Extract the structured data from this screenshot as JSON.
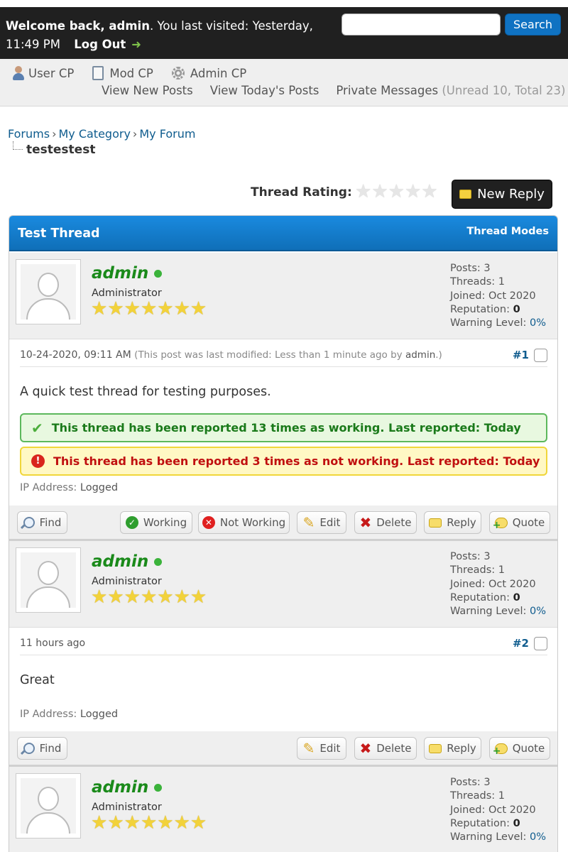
{
  "header": {
    "welcome_bold": "Welcome back, admin",
    "welcome_rest": ". You last visited: Yesterday,",
    "visit_time": "11:49 PM",
    "logout_label": "Log Out",
    "search_placeholder": "",
    "search_button": "Search"
  },
  "nav": {
    "user_cp": "User CP",
    "mod_cp": "Mod CP",
    "admin_cp": "Admin CP",
    "view_new_posts": "View New Posts",
    "view_todays_posts": "View Today's Posts",
    "private_messages": "Private Messages",
    "pm_counts": "(Unread 10, Total 23)"
  },
  "breadcrumb": {
    "forums": "Forums",
    "category": "My Category",
    "forum": "My Forum",
    "current": "testestest"
  },
  "thread_rating_label": "Thread Rating:",
  "thread_rating_value": 0,
  "new_reply_label": "New Reply",
  "thread": {
    "title": "Test Thread",
    "modes_label": "Thread Modes"
  },
  "posts": [
    {
      "username": "admin",
      "user_title": "Administrator",
      "stars": 7,
      "posts_label": "Posts:",
      "posts": "3",
      "threads_label": "Threads:",
      "threads": "1",
      "joined_label": "Joined:",
      "joined": "Oct 2020",
      "rep_label": "Reputation:",
      "reputation": "0",
      "warn_label": "Warning Level:",
      "warning": "0%",
      "date": "10-24-2020, 09:11 AM",
      "modified_prefix": "(This post was last modified: Less than 1 minute ago by",
      "modified_by": "admin",
      "modified_suffix": ".)",
      "post_number": "#1",
      "message": "A quick test thread for testing purposes.",
      "notice_ok": "This thread has been reported 13 times as working. Last reported: Today",
      "notice_bad": "This thread has been reported 3 times as not working. Last reported: Today",
      "ip_label": "IP Address:",
      "ip_value": "Logged"
    },
    {
      "username": "admin",
      "user_title": "Administrator",
      "stars": 7,
      "posts_label": "Posts:",
      "posts": "3",
      "threads_label": "Threads:",
      "threads": "1",
      "joined_label": "Joined:",
      "joined": "Oct 2020",
      "rep_label": "Reputation:",
      "reputation": "0",
      "warn_label": "Warning Level:",
      "warning": "0%",
      "date": "11 hours ago",
      "post_number": "#2",
      "message": "Great",
      "ip_label": "IP Address:",
      "ip_value": "Logged"
    },
    {
      "username": "admin",
      "user_title": "Administrator",
      "stars": 7,
      "posts_label": "Posts:",
      "posts": "3",
      "threads_label": "Threads:",
      "threads": "1",
      "joined_label": "Joined:",
      "joined": "Oct 2020",
      "rep_label": "Reputation:",
      "reputation": "0",
      "warn_label": "Warning Level:",
      "warning": "0%"
    }
  ],
  "buttons": {
    "find": "Find",
    "working": "Working",
    "not_working": "Not Working",
    "edit": "Edit",
    "delete": "Delete",
    "reply": "Reply",
    "quote": "Quote"
  },
  "colors": {
    "topbar": "#202020",
    "thread_header": "#0f6fb8",
    "username": "#1a8a1a",
    "link": "#0f5c8e"
  }
}
